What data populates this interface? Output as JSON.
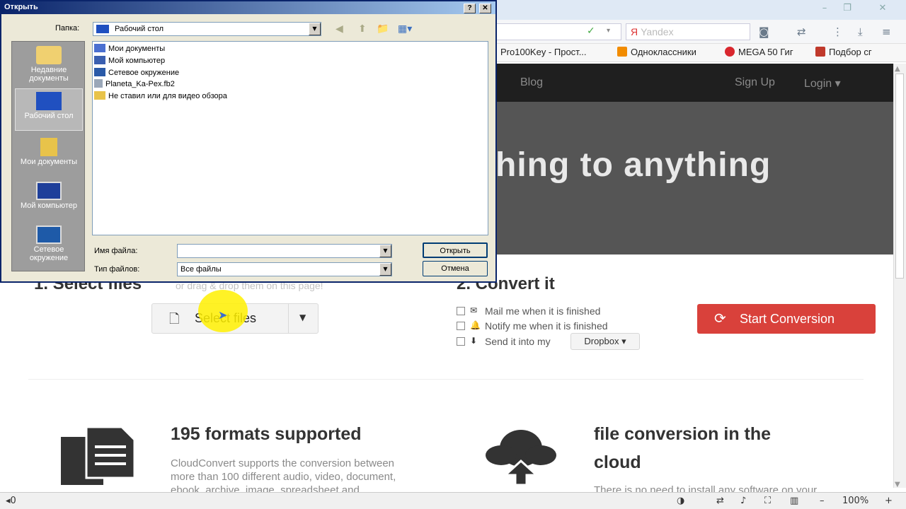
{
  "browser": {
    "window_controls": [
      "–",
      "❐",
      "✕"
    ],
    "search_placeholder": "Yandex",
    "bookmarks": [
      {
        "label": "Pro100Key - Прост...",
        "color": "#2c6fd1"
      },
      {
        "label": "Одноклассники",
        "color": "#f28c00"
      },
      {
        "label": "MEGA 50 Гиг",
        "color": "#d9272e"
      },
      {
        "label": "Подбор сг",
        "color": "#c0392b"
      }
    ],
    "zoom": "100%"
  },
  "site": {
    "nav": [
      "Blog",
      "Sign Up",
      "Login ▾"
    ],
    "hero_text": "hing to anything",
    "step1_title": "1. Select files",
    "step1_hint": "or drag & drop them on this page!",
    "select_button": "Select files",
    "step2_title": "2. Convert it",
    "options": [
      {
        "icon": "✉",
        "label": "Mail me when it is finished"
      },
      {
        "icon": "🔔",
        "label": "Notify me when it is finished"
      },
      {
        "icon": "⬇",
        "label": "Send it into my"
      }
    ],
    "dropbox_button": "Dropbox ▾",
    "start_button": "Start Conversion",
    "feature1_title": "195 formats supported",
    "feature1_text": [
      "CloudConvert supports the conversion between",
      "more than 100 different audio, video, document,",
      "ebook, archive, image, spreadsheet and"
    ],
    "feature2_title_lines": [
      "file conversion in the",
      "cloud"
    ],
    "feature2_text": "There is no need to install any software on your"
  },
  "dialog": {
    "title": "Открыть",
    "lookin_label": "Папка:",
    "lookin_value": "Рабочий стол",
    "places": [
      "Недавние документы",
      "Рабочий стол",
      "Мои документы",
      "Мой компьютер",
      "Сетевое окружение"
    ],
    "files": [
      {
        "name": "Мои документы",
        "color": "#4a6fd0"
      },
      {
        "name": "Мой компьютер",
        "color": "#3a5fb0"
      },
      {
        "name": "Сетевое окружение",
        "color": "#2a5aa8"
      },
      {
        "name": "Planeta_Ka-Pex.fb2",
        "color": "#9aa7b8"
      },
      {
        "name": "Не ставил  или для видео обзора",
        "color": "#e8c34a"
      }
    ],
    "filename_label": "Имя файла:",
    "filename_value": "",
    "filetype_label": "Тип файлов:",
    "filetype_value": "Все файлы",
    "open_button": "Открыть",
    "cancel_button": "Отмена"
  }
}
